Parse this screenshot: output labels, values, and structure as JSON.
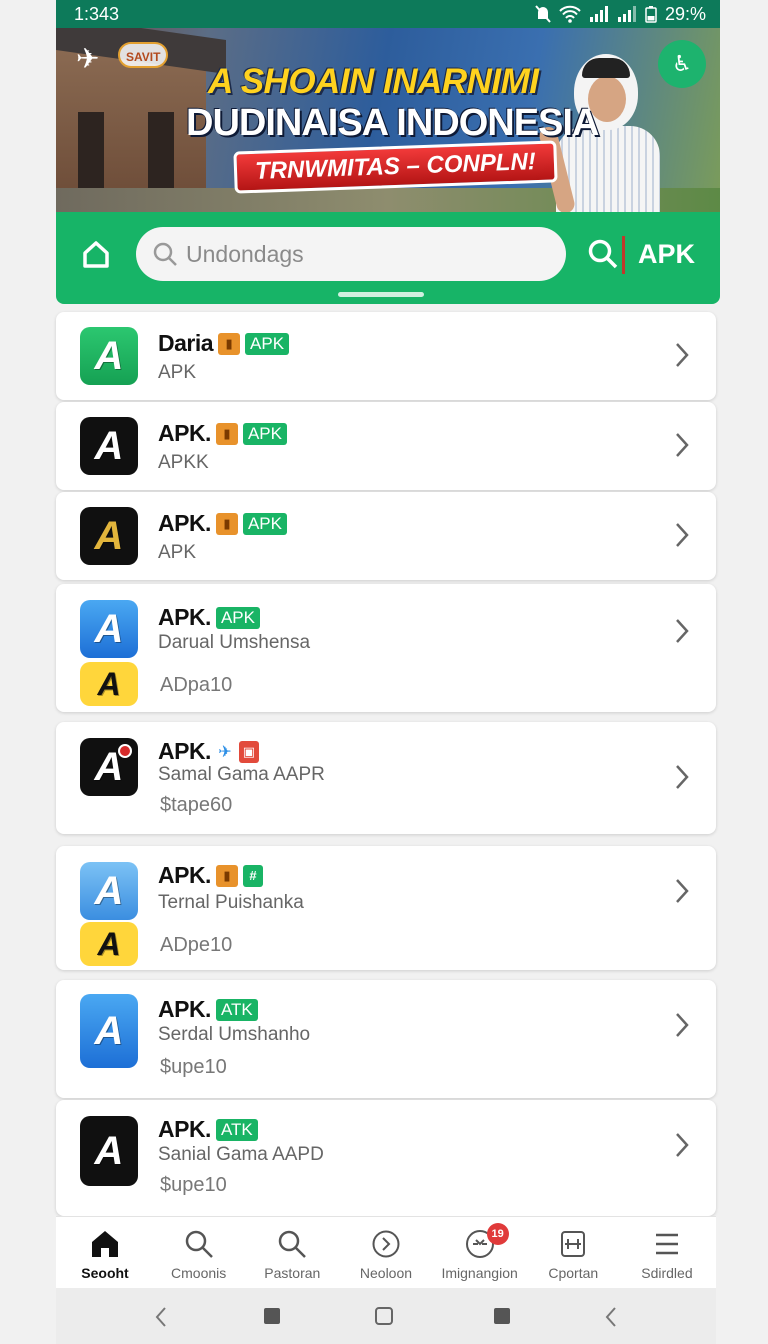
{
  "status_bar": {
    "time": "1:343",
    "battery": "29:%"
  },
  "banner": {
    "brand": "SAVIT",
    "title_line1": "A SHOAIN INARNIMI",
    "title_line2": "DUDINAISA INDONESIA",
    "promo": "TRNWMITAS – CONPLN!"
  },
  "search": {
    "placeholder": "Undondags",
    "action_label": "APK"
  },
  "apps": [
    {
      "title": "Daria",
      "subtitle": "APK",
      "meta": "",
      "badges": [
        "orange",
        "apk"
      ]
    },
    {
      "title": "APK.",
      "subtitle": "APKK",
      "meta": "",
      "badges": [
        "orange",
        "apk"
      ]
    },
    {
      "title": "APK.",
      "subtitle": "APK",
      "meta": "",
      "badges": [
        "orange",
        "apk"
      ]
    },
    {
      "title": "APK.",
      "subtitle": "Darual Umshensa",
      "meta": "ADpa10",
      "badges": [
        "apk"
      ]
    },
    {
      "title": "APK.",
      "subtitle": "Samal Gama AAPR",
      "meta": "$tape60",
      "badges": [
        "blue",
        "red"
      ]
    },
    {
      "title": "APK.",
      "subtitle": "Ternal Puishanka",
      "meta": "ADpe10",
      "badges": [
        "orange",
        "green"
      ]
    },
    {
      "title": "APK.",
      "subtitle": "Serdal Umshanho",
      "meta": "$upe10",
      "badges": [
        "apk2"
      ]
    },
    {
      "title": "APK.",
      "subtitle": "Sanial Gama AAPD",
      "meta": "$upe10",
      "badges": [
        "apk2"
      ]
    }
  ],
  "badges": {
    "apk": "APK",
    "apk2": "ATK"
  },
  "bottom_nav": [
    {
      "label": "Seooht",
      "icon": "home-icon",
      "active": true
    },
    {
      "label": "Cmoonis",
      "icon": "search-icon"
    },
    {
      "label": "Pastoran",
      "icon": "search-icon"
    },
    {
      "label": "Neoloon",
      "icon": "chevron-circle-icon"
    },
    {
      "label": "Imignangion",
      "icon": "gauge-icon",
      "badge": "19"
    },
    {
      "label": "Cportan",
      "icon": "calendar-icon"
    },
    {
      "label": "Sdirdled",
      "icon": "menu-icon"
    }
  ],
  "colors": {
    "primary": "#17b467",
    "status_bar": "#0d7a5a",
    "badge_apk": "#19b465",
    "badge_orange": "#e8922b"
  }
}
